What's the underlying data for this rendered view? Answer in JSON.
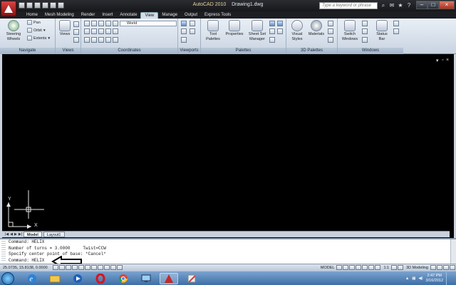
{
  "titlebar": {
    "app_name": "AutoCAD 2010",
    "document": "Drawing1.dwg",
    "search_placeholder": "Type a keyword or phrase"
  },
  "tabs": [
    {
      "label": "Home"
    },
    {
      "label": "Mesh Modeling"
    },
    {
      "label": "Render"
    },
    {
      "label": "Insert"
    },
    {
      "label": "Annotate"
    },
    {
      "label": "View"
    },
    {
      "label": "Manage"
    },
    {
      "label": "Output"
    },
    {
      "label": "Express Tools"
    }
  ],
  "ribbon": {
    "navigate": {
      "label": "Navigate",
      "steering": "Steering",
      "wheels": "Wheels",
      "pan": "Pan",
      "orbit": "Orbit",
      "extents": "Extents"
    },
    "views": {
      "label": "Views",
      "views_btn": "Views"
    },
    "coordinates": {
      "label": "Coordinates",
      "ucs_value": "World"
    },
    "viewports": {
      "label": "Viewports"
    },
    "palettes": {
      "label": "Palettes",
      "tool": "Tool",
      "palettes": "Palettes",
      "properties": "Properties",
      "sheet_set": "Sheet Set",
      "manager": "Manager"
    },
    "palettes3d": {
      "label": "3D Palettes",
      "visual": "Visual",
      "styles": "Styles",
      "materials": "Materials"
    },
    "windows": {
      "label": "Windows",
      "switch": "Switch",
      "windows": "Windows",
      "status": "Status",
      "bar": "Bar"
    }
  },
  "drawing": {
    "ucs_x": "X",
    "ucs_y": "Y"
  },
  "layout_tabs": [
    {
      "label": "Model"
    },
    {
      "label": "Layout1"
    }
  ],
  "command": {
    "lines": [
      "Command: HELIX",
      "Number of turns = 3.0000     Twist=CCW",
      "Specify center point of base: *Cancel*",
      "Command: HELIX"
    ]
  },
  "status": {
    "coords": "25.0735, 15.8138, 0.0000",
    "model": "MODEL",
    "scale": "1:1",
    "workspace": "3D Modeling"
  },
  "taskbar": {
    "time": "2:47 PM",
    "date": "3/16/2012"
  },
  "colors": {
    "canvas": "#000000",
    "ribbon": "#dde5ee",
    "autocad_red": "#c62828"
  }
}
